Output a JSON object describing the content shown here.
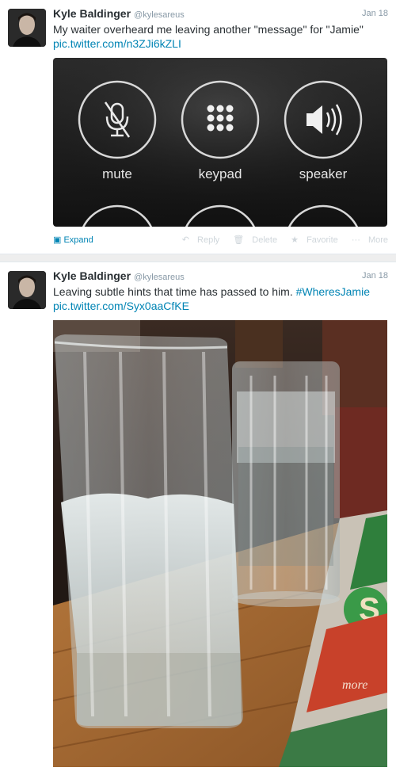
{
  "tweets": [
    {
      "name": "Kyle Baldinger",
      "handle": "@kylesareus",
      "date": "Jan 18",
      "text": "My waiter overheard me leaving another \"message\" for \"Jamie\"",
      "link": "pic.twitter.com/n3ZJi6kZLI",
      "photo": {
        "buttons": [
          {
            "label": "mute",
            "icon": "microphone-muted-icon"
          },
          {
            "label": "keypad",
            "icon": "keypad-icon"
          },
          {
            "label": "speaker",
            "icon": "speaker-icon"
          }
        ]
      },
      "actions": {
        "expand": "Expand",
        "reply": "Reply",
        "delete": "Delete",
        "favorite": "Favorite",
        "more": "More"
      }
    },
    {
      "name": "Kyle Baldinger",
      "handle": "@kylesareus",
      "date": "Jan 18",
      "text": "Leaving subtle hints that time has passed to him.",
      "hashtag": "#WheresJamie",
      "link": "pic.twitter.com/Syx0aaCfKE",
      "photo": {
        "menu_text": "more"
      }
    }
  ],
  "colors": {
    "link": "#0084b4",
    "name": "#292f33",
    "meta": "#8899a6"
  }
}
